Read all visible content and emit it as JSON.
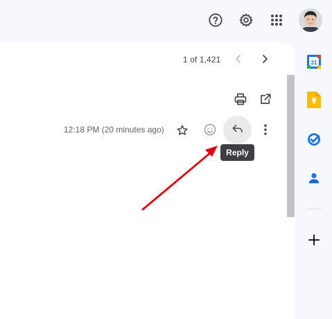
{
  "header": {
    "help_icon": "help-icon",
    "settings_icon": "gear-icon",
    "apps_icon": "apps-grid-icon",
    "avatar_icon": "account-avatar"
  },
  "pager": {
    "text": "1 of 1,421",
    "prev_icon": "chevron-left-icon",
    "next_icon": "chevron-right-icon"
  },
  "toolbar": {
    "print_icon": "print-icon",
    "open_new_window_icon": "open-in-new-icon"
  },
  "message": {
    "timestamp": "12:18 PM (20 minutes ago)",
    "star_icon": "star-icon",
    "emoji_icon": "emoji-reaction-icon",
    "reply_icon": "reply-icon",
    "more_icon": "more-vert-icon"
  },
  "tooltip": {
    "label": "Reply"
  },
  "side_apps": {
    "calendar_day": "31",
    "calendar_icon": "calendar-icon",
    "keep_icon": "keep-icon",
    "tasks_icon": "tasks-icon",
    "contacts_icon": "contacts-icon",
    "add_icon": "plus-icon"
  },
  "colors": {
    "background": "#f6f8fc",
    "panel": "#ffffff",
    "tooltip_bg": "#3c4043",
    "annotation_arrow": "#e3000f",
    "keep_yellow": "#fbbc04",
    "google_blue": "#1a73e8"
  }
}
